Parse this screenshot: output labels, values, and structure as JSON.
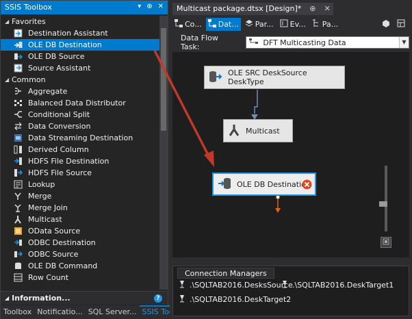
{
  "toolbox": {
    "title": "SSIS Toolbox",
    "groups": [
      {
        "label": "Favorites",
        "items": [
          {
            "label": "Destination Assistant",
            "icon": "destination-assistant-icon"
          },
          {
            "label": "OLE DB Destination",
            "icon": "oledb-destination-icon",
            "selected": true
          },
          {
            "label": "OLE DB Source",
            "icon": "oledb-source-icon"
          },
          {
            "label": "Source Assistant",
            "icon": "source-assistant-icon"
          }
        ]
      },
      {
        "label": "Common",
        "items": [
          {
            "label": "Aggregate",
            "icon": "aggregate-icon"
          },
          {
            "label": "Balanced Data Distributor",
            "icon": "balanced-distributor-icon"
          },
          {
            "label": "Conditional Split",
            "icon": "conditional-split-icon"
          },
          {
            "label": "Data Conversion",
            "icon": "data-conversion-icon"
          },
          {
            "label": "Data Streaming Destination",
            "icon": "data-streaming-icon"
          },
          {
            "label": "Derived Column",
            "icon": "derived-column-icon"
          },
          {
            "label": "HDFS File Destination",
            "icon": "hdfs-destination-icon"
          },
          {
            "label": "HDFS File Source",
            "icon": "hdfs-source-icon"
          },
          {
            "label": "Lookup",
            "icon": "lookup-icon"
          },
          {
            "label": "Merge",
            "icon": "merge-icon"
          },
          {
            "label": "Merge Join",
            "icon": "merge-join-icon"
          },
          {
            "label": "Multicast",
            "icon": "multicast-icon"
          },
          {
            "label": "OData Source",
            "icon": "odata-source-icon"
          },
          {
            "label": "ODBC Destination",
            "icon": "odbc-destination-icon"
          },
          {
            "label": "ODBC Source",
            "icon": "odbc-source-icon"
          },
          {
            "label": "OLE DB Command",
            "icon": "oledb-command-icon"
          },
          {
            "label": "Row Count",
            "icon": "row-count-icon"
          }
        ]
      }
    ],
    "info_label": "Information...",
    "bottom_tabs": [
      "Toolbox",
      "Notificatio...",
      "SQL Server...",
      "SSIS Toolbox"
    ]
  },
  "designer": {
    "doc_tab": "Multicast package.dtsx [Design]*",
    "tabs": [
      "Co...",
      "Dat...",
      "Par...",
      "Ev...",
      "Pa..."
    ],
    "active_tab": 1,
    "data_flow_task_label": "Data Flow Task:",
    "data_flow_task_value": "DFT Multicasting Data",
    "components": {
      "source": "OLE SRC DeskSource DeskType",
      "multicast": "Multicast",
      "destination": "OLE DB Destination"
    },
    "connection_managers": {
      "tab_label": "Connection Managers",
      "items": [
        ".\\SQLTAB2016.DesksSource",
        ".\\SQLTAB2016.DeskTarget1",
        ".\\SQLTAB2016.DeskTarget2"
      ]
    }
  },
  "colors": {
    "accent": "#007acc",
    "drag_arrow": "#c0392b",
    "error_badge": "#e04a1e"
  }
}
